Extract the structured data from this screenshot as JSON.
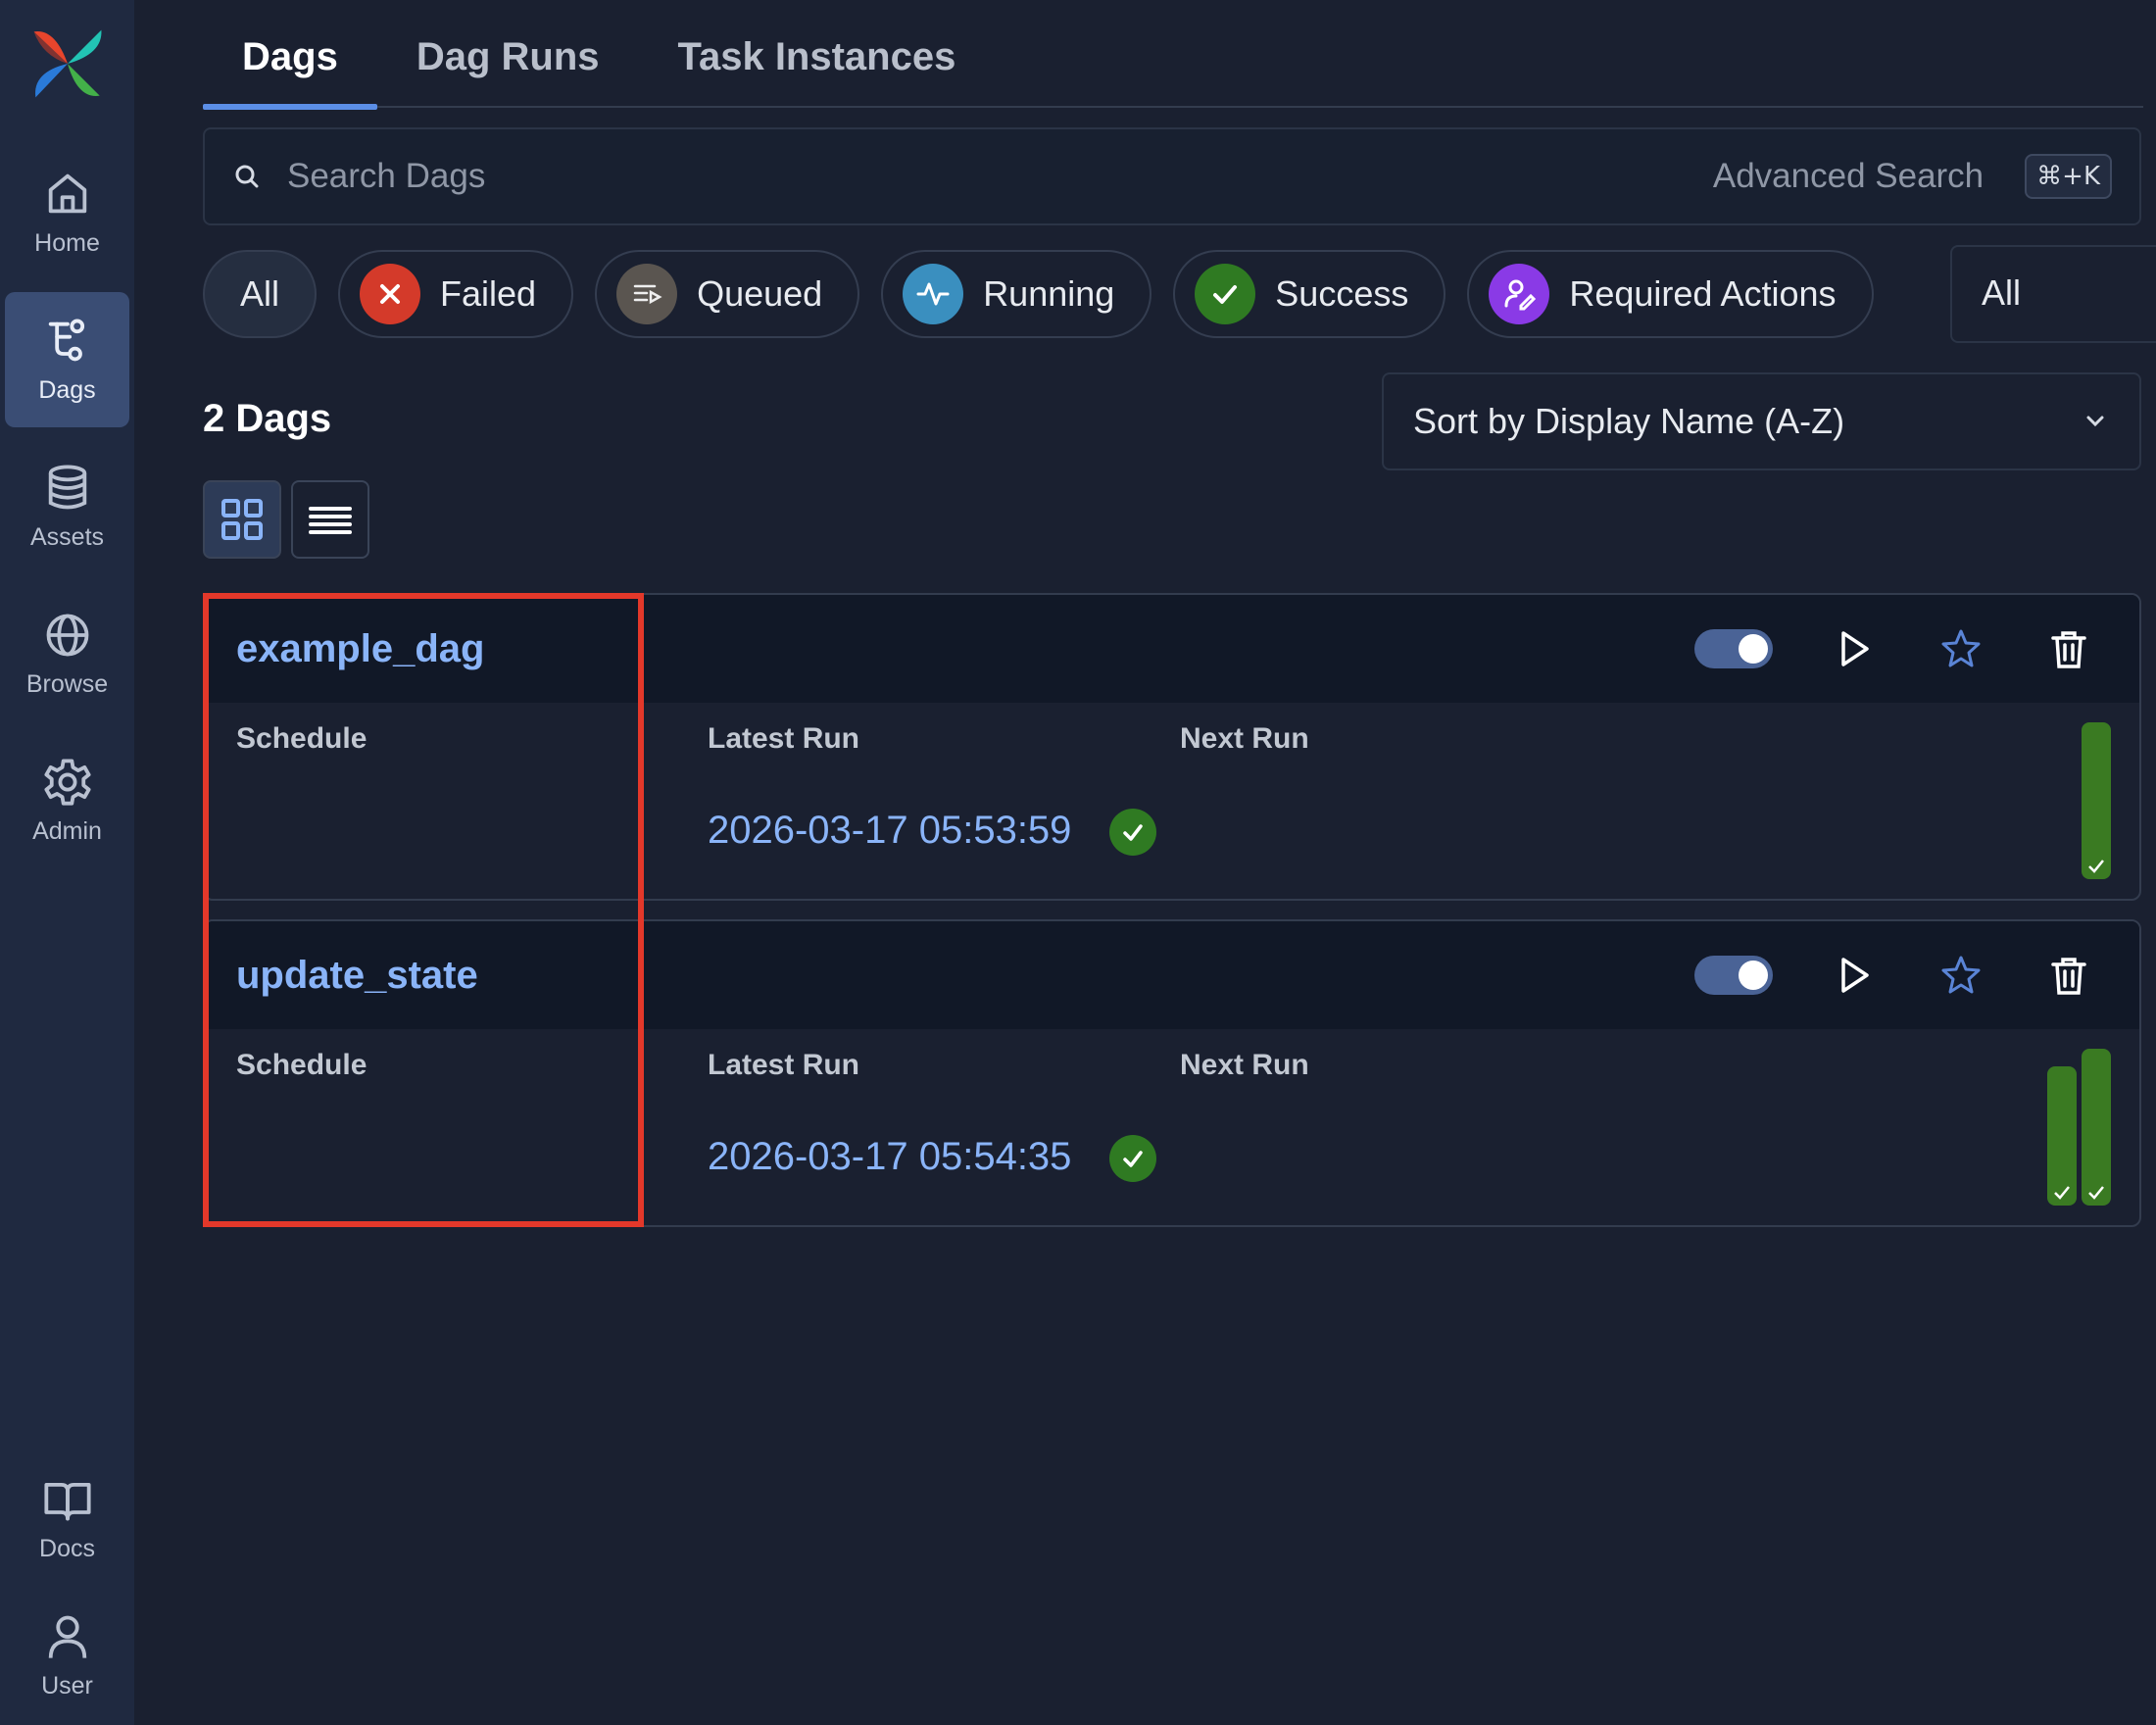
{
  "sidebar": {
    "items": [
      {
        "label": "Home",
        "icon": "home-icon"
      },
      {
        "label": "Dags",
        "icon": "dags-icon"
      },
      {
        "label": "Assets",
        "icon": "database-icon"
      },
      {
        "label": "Browse",
        "icon": "globe-icon"
      },
      {
        "label": "Admin",
        "icon": "gear-icon"
      }
    ],
    "bottom": [
      {
        "label": "Docs",
        "icon": "book-icon"
      },
      {
        "label": "User",
        "icon": "user-icon"
      }
    ]
  },
  "tabs": [
    {
      "label": "Dags"
    },
    {
      "label": "Dag Runs"
    },
    {
      "label": "Task Instances"
    }
  ],
  "search": {
    "placeholder": "Search Dags",
    "advanced": "Advanced Search",
    "shortcut": "⌘+K"
  },
  "filters": {
    "all": "All",
    "failed": "Failed",
    "queued": "Queued",
    "running": "Running",
    "success": "Success",
    "required": "Required Actions",
    "select_value": "All"
  },
  "colors": {
    "failed": "#d43a2a",
    "queued": "#5a5550",
    "running": "#3a8fbf",
    "success": "#2f7a22",
    "required": "#8a3ae6",
    "link": "#8ab4f8"
  },
  "list": {
    "count": "2 Dags",
    "sort": "Sort by Display Name (A-Z)"
  },
  "dags": [
    {
      "name": "example_dag",
      "schedule_label": "Schedule",
      "latest_label": "Latest Run",
      "next_label": "Next Run",
      "latest_run": "2026-03-17 05:53:59",
      "latest_state": "success",
      "recent_runs": [
        "success"
      ]
    },
    {
      "name": "update_state",
      "schedule_label": "Schedule",
      "latest_label": "Latest Run",
      "next_label": "Next Run",
      "latest_run": "2026-03-17 05:54:35",
      "latest_state": "success",
      "recent_runs": [
        "success",
        "success"
      ]
    }
  ]
}
